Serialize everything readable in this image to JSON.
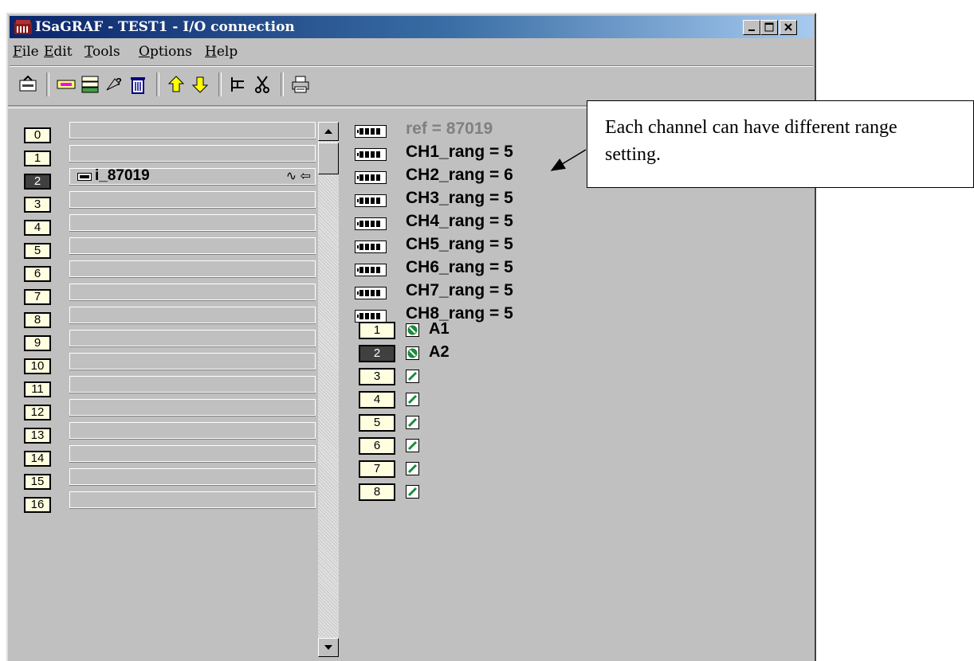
{
  "window": {
    "title": "ISaGRAF - TEST1 - I/O connection"
  },
  "menu": {
    "items": [
      {
        "u": "F",
        "rest": "ile"
      },
      {
        "u": "E",
        "rest": "dit"
      },
      {
        "u": "T",
        "rest": "ools"
      },
      {
        "u": "O",
        "rest": "ptions"
      },
      {
        "u": "H",
        "rest": "elp"
      }
    ]
  },
  "channels": {
    "numbers": [
      "0",
      "1",
      "2",
      "3",
      "4",
      "5",
      "6",
      "7",
      "8",
      "9",
      "10",
      "11",
      "12",
      "13",
      "14",
      "15",
      "16"
    ],
    "selected": "2",
    "board_name": "i_87019",
    "board_mark": "∿ ⇦"
  },
  "params": {
    "items": [
      "ref = 87019",
      "CH1_rang = 5",
      "CH2_rang = 6",
      "CH3_rang = 5",
      "CH4_rang = 5",
      "CH5_rang = 5",
      "CH6_rang = 5",
      "CH7_rang = 5",
      "CH8_rang = 5"
    ]
  },
  "io": {
    "numbers": [
      "1",
      "2",
      "3",
      "4",
      "5",
      "6",
      "7",
      "8"
    ],
    "labels": [
      "A1",
      "A2",
      "",
      "",
      "",
      "",
      "",
      ""
    ],
    "selected": "2"
  },
  "callout": {
    "text": "Each channel can have different range setting."
  },
  "colors": {
    "title_from": "#0a246a",
    "title_to": "#a6caf0",
    "face": "#c0c0c0",
    "number_bg": "#ffffe0",
    "connected_icon": "#1a8a3a"
  }
}
